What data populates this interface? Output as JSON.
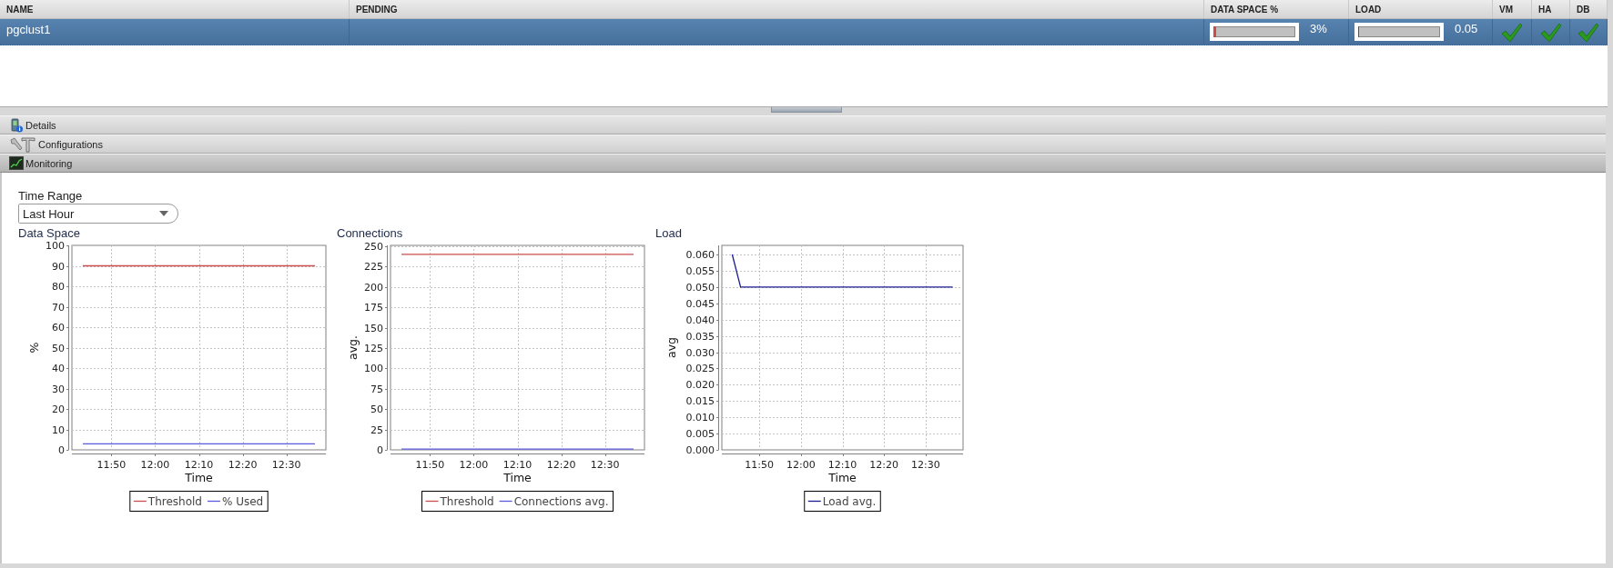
{
  "table": {
    "columns": [
      "NAME",
      "PENDING",
      "DATA SPACE %",
      "LOAD",
      "VM",
      "HA",
      "DB"
    ],
    "rows": [
      {
        "selected": true,
        "name": "pgclust1",
        "data_space": {
          "level": 0.03,
          "reading": "3%"
        },
        "load": {
          "level": 0.01,
          "reading": "0.05"
        },
        "vm": {
          "checked": true
        },
        "ha": {
          "checked": true
        },
        "db": {
          "checked": true
        }
      }
    ]
  },
  "sections": [
    {
      "kind": "details",
      "label": "Details",
      "expanded": false
    },
    {
      "kind": "configurations",
      "label": "Configurations",
      "expanded": false
    },
    {
      "kind": "monitoring",
      "label": "Monitoring",
      "expanded": true
    }
  ],
  "monitoring": {
    "time_range": {
      "label": "Time Range",
      "value": "Last Hour"
    },
    "charts": [
      {
        "chart_data": {
          "type": "line",
          "grid": true,
          "legend": "bottom",
          "title": "Data Space",
          "xlabel": "Time",
          "ylabel": "%",
          "x": [
            703.5,
            756.5
          ],
          "xlim": [
            701,
            759
          ],
          "ylim": [
            0,
            100
          ],
          "xticks": [
            {
              "value": 710,
              "label": "11:50"
            },
            {
              "value": 720,
              "label": "12:00"
            },
            {
              "value": 730,
              "label": "12:10"
            },
            {
              "value": 740,
              "label": "12:20"
            },
            {
              "value": 750,
              "label": "12:30"
            }
          ],
          "yticks": [
            {
              "value": 0,
              "label": "0"
            },
            {
              "value": 10,
              "label": "10"
            },
            {
              "value": 20,
              "label": "20"
            },
            {
              "value": 30,
              "label": "30"
            },
            {
              "value": 40,
              "label": "40"
            },
            {
              "value": 50,
              "label": "50"
            },
            {
              "value": 60,
              "label": "60"
            },
            {
              "value": 70,
              "label": "70"
            },
            {
              "value": 80,
              "label": "80"
            },
            {
              "value": 90,
              "label": "90"
            },
            {
              "value": 100,
              "label": "100"
            }
          ],
          "series": [
            {
              "name": "Threshold",
              "color": "#cc4c4c",
              "values": [
                90,
                90
              ]
            },
            {
              "name": "% Used",
              "color": "#5a5ae0",
              "values": [
                3,
                3
              ]
            }
          ]
        }
      },
      {
        "chart_data": {
          "type": "line",
          "grid": true,
          "legend": "bottom",
          "title": "Connections",
          "xlabel": "Time",
          "ylabel": "avg.",
          "x": [
            703.5,
            756.5
          ],
          "xlim": [
            701,
            759
          ],
          "ylim": [
            0,
            251
          ],
          "xticks": [
            {
              "value": 710,
              "label": "11:50"
            },
            {
              "value": 720,
              "label": "12:00"
            },
            {
              "value": 730,
              "label": "12:10"
            },
            {
              "value": 740,
              "label": "12:20"
            },
            {
              "value": 750,
              "label": "12:30"
            }
          ],
          "yticks": [
            {
              "value": 0,
              "label": "0"
            },
            {
              "value": 25,
              "label": "25"
            },
            {
              "value": 50,
              "label": "50"
            },
            {
              "value": 75,
              "label": "75"
            },
            {
              "value": 100,
              "label": "100"
            },
            {
              "value": 125,
              "label": "125"
            },
            {
              "value": 150,
              "label": "150"
            },
            {
              "value": 175,
              "label": "175"
            },
            {
              "value": 200,
              "label": "200"
            },
            {
              "value": 225,
              "label": "225"
            },
            {
              "value": 250,
              "label": "250"
            }
          ],
          "series": [
            {
              "name": "Threshold",
              "color": "#cc4c4c",
              "values": [
                240,
                240
              ]
            },
            {
              "name": "Connections avg.",
              "color": "#5a5ae0",
              "values": [
                1,
                1
              ]
            }
          ]
        }
      },
      {
        "chart_data": {
          "type": "line",
          "grid": true,
          "legend": "bottom",
          "title": "Load",
          "xlabel": "Time",
          "ylabel": "avg",
          "x": [
            703.5,
            705.5,
            756.5
          ],
          "xlim": [
            701,
            759
          ],
          "ylim": [
            0,
            0.0628
          ],
          "xticks": [
            {
              "value": 710,
              "label": "11:50"
            },
            {
              "value": 720,
              "label": "12:00"
            },
            {
              "value": 730,
              "label": "12:10"
            },
            {
              "value": 740,
              "label": "12:20"
            },
            {
              "value": 750,
              "label": "12:30"
            }
          ],
          "yticks": [
            {
              "value": 0,
              "label": "0.000"
            },
            {
              "value": 0.005,
              "label": "0.005"
            },
            {
              "value": 0.01,
              "label": "0.010"
            },
            {
              "value": 0.015,
              "label": "0.015"
            },
            {
              "value": 0.02,
              "label": "0.020"
            },
            {
              "value": 0.025,
              "label": "0.025"
            },
            {
              "value": 0.03,
              "label": "0.030"
            },
            {
              "value": 0.035,
              "label": "0.035"
            },
            {
              "value": 0.04,
              "label": "0.040"
            },
            {
              "value": 0.045,
              "label": "0.045"
            },
            {
              "value": 0.05,
              "label": "0.050"
            },
            {
              "value": 0.055,
              "label": "0.055"
            },
            {
              "value": 0.06,
              "label": "0.060"
            }
          ],
          "series": [
            {
              "name": "Load avg.",
              "color": "#1c1c8e",
              "values": [
                0.06,
                0.05,
                0.05
              ]
            }
          ]
        }
      }
    ]
  }
}
